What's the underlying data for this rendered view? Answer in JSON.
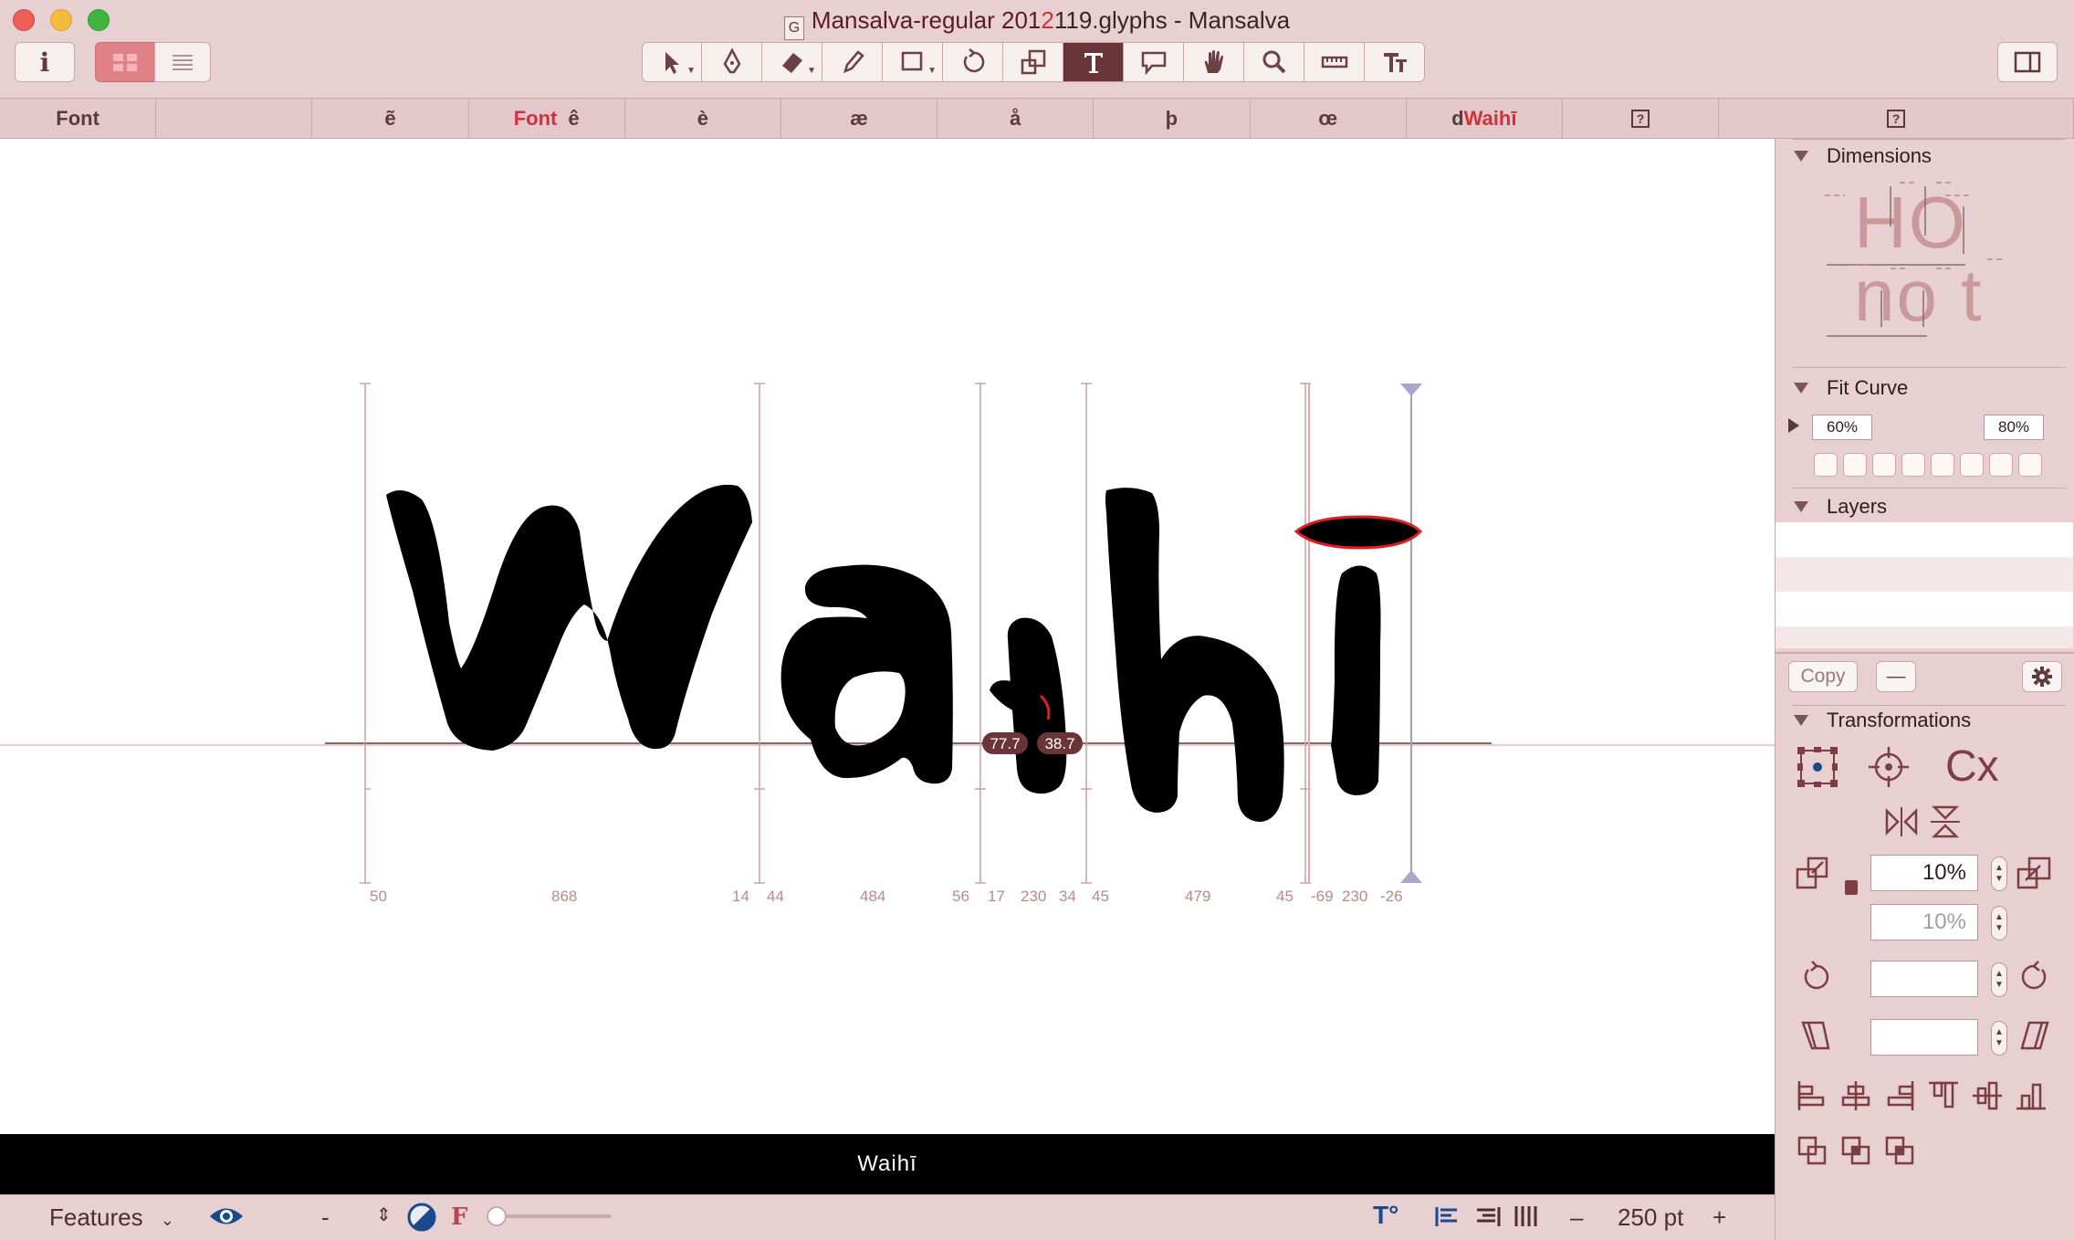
{
  "window": {
    "title_prefix": "Mansalva-regular 201",
    "title_suffix": "119.glyphs - Mansalva",
    "title_overlap": "2",
    "doc_icon": "glyphs-doc-icon"
  },
  "toolbar": {
    "info_label": "i",
    "tools": [
      {
        "name": "select-tool",
        "icon": "arrow-icon"
      },
      {
        "name": "pen-tool",
        "icon": "pen-icon"
      },
      {
        "name": "eraser-tool",
        "icon": "eraser-icon"
      },
      {
        "name": "pencil-tool",
        "icon": "pencil-icon"
      },
      {
        "name": "shape-tool",
        "icon": "rectangle-icon"
      },
      {
        "name": "rotate-tool",
        "icon": "rotate-icon"
      },
      {
        "name": "scale-tool",
        "icon": "scale-icon"
      },
      {
        "name": "text-tool",
        "icon": "text-icon",
        "active": true
      },
      {
        "name": "annotation-tool",
        "icon": "speech-bubble-icon"
      },
      {
        "name": "hand-tool",
        "icon": "hand-icon"
      },
      {
        "name": "zoom-tool",
        "icon": "magnifier-icon"
      },
      {
        "name": "measure-tool",
        "icon": "ruler-icon"
      },
      {
        "name": "metrics-tool",
        "icon": "metrics-text-icon"
      }
    ]
  },
  "tabs": [
    {
      "label": "Font"
    },
    {
      "label": ""
    },
    {
      "label": "ẽ"
    },
    {
      "label": "ê",
      "red": "Font"
    },
    {
      "label": "è"
    },
    {
      "label": "æ"
    },
    {
      "label": "å"
    },
    {
      "label": "þ"
    },
    {
      "label": "œ"
    },
    {
      "label": "Waihī",
      "prefix": "d"
    },
    {
      "label": "?",
      "qm": true
    },
    {
      "label": "?",
      "qm": true
    }
  ],
  "canvas": {
    "metrics": [
      "50",
      "868",
      "14",
      "44",
      "484",
      "56",
      "17",
      "230",
      "34",
      "45",
      "479",
      "45",
      "-69",
      "230",
      "-26"
    ],
    "kern_badges": [
      "77.7",
      "38.7"
    ]
  },
  "preview_text": "Waihī",
  "bottom": {
    "features_label": "Features",
    "dash": "-",
    "f_label": "F",
    "zoom_value": "250 pt",
    "zoom_minus": "–",
    "zoom_plus": "+"
  },
  "sidebar": {
    "dimensions_label": "Dimensions",
    "dims_upper": "HO",
    "dims_lower": "no t",
    "fit_curve_label": "Fit Curve",
    "fit_min": "60%",
    "fit_max": "80%",
    "layers_label": "Layers",
    "copy_label": "Copy",
    "minus_label": "—",
    "transformations_label": "Transformations",
    "cx_label": "Cx",
    "scale_x": "10%",
    "scale_y": "10%",
    "rotate_value": "",
    "slant_value": ""
  },
  "colors": {
    "chrome": "#e8cfd1",
    "active_tool": "#6b3438",
    "accent_red": "#d4303a"
  }
}
